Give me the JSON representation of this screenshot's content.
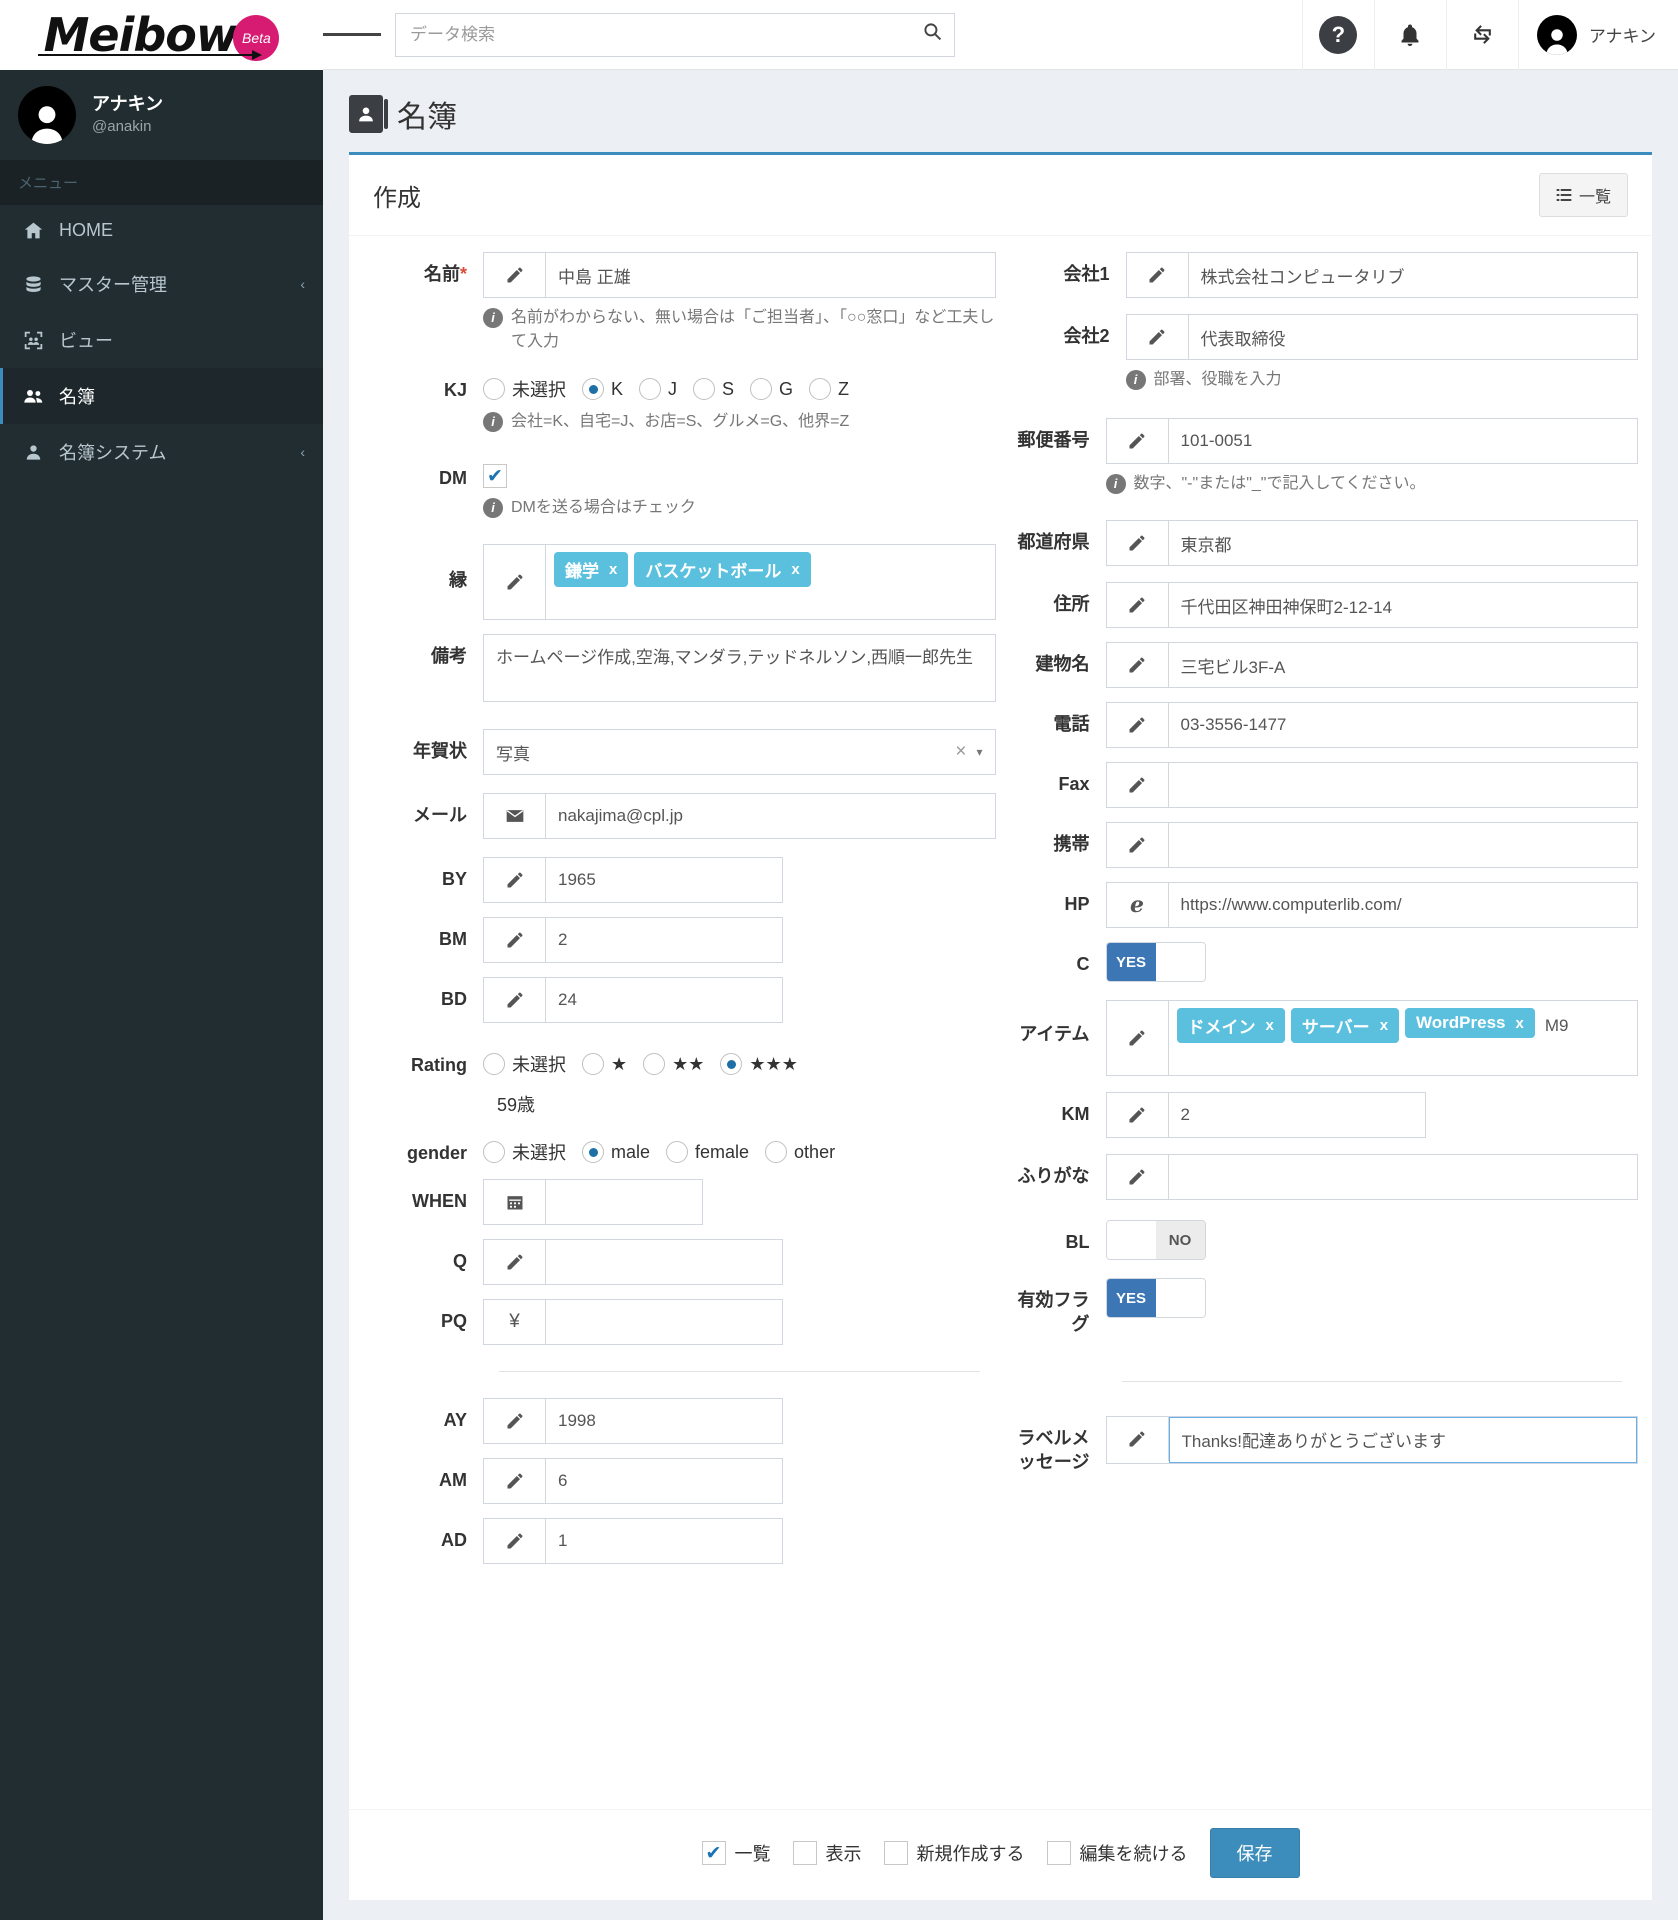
{
  "brand": {
    "name": "Meibow",
    "badge": "Beta"
  },
  "profile": {
    "name": "アナキン",
    "handle": "@anakin"
  },
  "sidebar": {
    "menu_title": "メニュー",
    "items": [
      {
        "label": "HOME",
        "icon": "home-icon",
        "caret": ""
      },
      {
        "label": "マスター管理",
        "icon": "database-icon",
        "caret": "‹"
      },
      {
        "label": "ビュー",
        "icon": "view-group-icon",
        "caret": ""
      },
      {
        "label": "名簿",
        "icon": "users-icon",
        "caret": ""
      },
      {
        "label": "名簿システム",
        "icon": "user-icon",
        "caret": "‹"
      }
    ]
  },
  "topbar": {
    "search_placeholder": "データ検索",
    "help_label": "?",
    "user_name": "アナキン"
  },
  "page": {
    "title": "名簿",
    "card_title": "作成",
    "list_button": "一覧"
  },
  "form": {
    "left": {
      "name": {
        "label": "名前",
        "required": "*",
        "value": "中島 正雄",
        "hint": "名前がわからない、無い場合は「ご担当者」、「○○窓口」など工夫して入力"
      },
      "kj": {
        "label": "KJ",
        "options": [
          "未選択",
          "K",
          "J",
          "S",
          "G",
          "Z"
        ],
        "selected": "K",
        "hint": "会社=K、自宅=J、お店=S、グルメ=G、他界=Z"
      },
      "dm": {
        "label": "DM",
        "checked": true,
        "hint": "DMを送る場合はチェック"
      },
      "en": {
        "label": "縁",
        "tags": [
          "鎌学",
          "バスケットボール"
        ]
      },
      "biko": {
        "label": "備考",
        "value": "ホームページ作成,空海,マンダラ,テッドネルソン,西順一郎先生"
      },
      "nengajo": {
        "label": "年賀状",
        "value": "写真"
      },
      "mail": {
        "label": "メール",
        "value": "nakajima@cpl.jp"
      },
      "by": {
        "label": "BY",
        "value": "1965"
      },
      "bm": {
        "label": "BM",
        "value": "2"
      },
      "bd": {
        "label": "BD",
        "value": "24"
      },
      "rating": {
        "label": "Rating",
        "options": [
          "未選択",
          "★",
          "★★",
          "★★★"
        ],
        "selected": "★★★",
        "age": "59歳"
      },
      "gender": {
        "label": "gender",
        "options": [
          "未選択",
          "male",
          "female",
          "other"
        ],
        "selected": "male"
      },
      "when": {
        "label": "WHEN",
        "value": ""
      },
      "q": {
        "label": "Q",
        "value": ""
      },
      "pq": {
        "label": "PQ",
        "value": "",
        "addon": "¥"
      },
      "ay": {
        "label": "AY",
        "value": "1998"
      },
      "am": {
        "label": "AM",
        "value": "6"
      },
      "ad": {
        "label": "AD",
        "value": "1"
      }
    },
    "right": {
      "company1": {
        "label": "会社1",
        "value": "株式会社コンピュータリブ"
      },
      "company2": {
        "label": "会社2",
        "value": "代表取締役",
        "hint": "部署、役職を入力"
      },
      "zip": {
        "label": "郵便番号",
        "value": "101-0051",
        "hint": "数字、\"-\"または\"_\"で記入してください。"
      },
      "pref": {
        "label": "都道府県",
        "value": "東京都"
      },
      "addr": {
        "label": "住所",
        "value": "千代田区神田神保町2-12-14"
      },
      "building": {
        "label": "建物名",
        "value": "三宅ビル3F-A"
      },
      "tel": {
        "label": "電話",
        "value": "03-3556-1477"
      },
      "fax": {
        "label": "Fax",
        "value": ""
      },
      "mobile": {
        "label": "携帯",
        "value": ""
      },
      "hp": {
        "label": "HP",
        "value": "https://www.computerlib.com/"
      },
      "c": {
        "label": "C",
        "state": "YES"
      },
      "item": {
        "label": "アイテム",
        "tags": [
          "ドメイン",
          "サーバー",
          "WordPress"
        ],
        "extra": "M9"
      },
      "km": {
        "label": "KM",
        "value": "2"
      },
      "furigana": {
        "label": "ふりがな",
        "value": ""
      },
      "bl": {
        "label": "BL",
        "state": "NO"
      },
      "valid_flag": {
        "label": "有効フラグ",
        "state": "YES"
      },
      "label_message": {
        "label": "ラベルメッセージ",
        "value": "Thanks!配達ありがとうございます"
      }
    }
  },
  "footer": {
    "checkboxes": [
      {
        "label": "一覧",
        "checked": true
      },
      {
        "label": "表示",
        "checked": false
      },
      {
        "label": "新規作成する",
        "checked": false
      },
      {
        "label": "編集を続ける",
        "checked": false
      }
    ],
    "save_label": "保存"
  },
  "colors": {
    "accent": "#3c8dbc",
    "tag": "#5bc0de",
    "sidebar": "#222d32",
    "brand_badge": "#d81b72"
  }
}
